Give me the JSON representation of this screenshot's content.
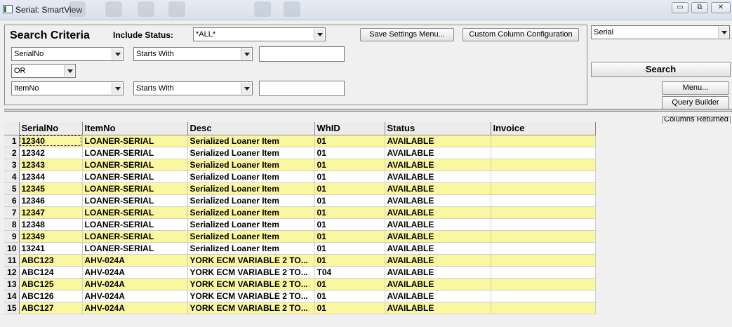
{
  "window": {
    "title": "Serial: SmartView",
    "controls": {
      "minimize": "▭",
      "restore": "⧉",
      "close": "✕"
    }
  },
  "criteria": {
    "title": "Search Criteria",
    "include_status_label": "Include Status:",
    "include_status_value": "*ALL*",
    "save_settings_label": "Save Settings Menu...",
    "custom_columns_label": "Custom Column Configuration",
    "row1": {
      "field": "SerialNo",
      "operator": "Starts With",
      "value": ""
    },
    "logic": "OR",
    "row2": {
      "field": "ItemNo",
      "operator": "Starts With",
      "value": ""
    }
  },
  "right_panel": {
    "view_select": "Serial",
    "search_label": "Search",
    "menu_label": "Menu...",
    "query_builder_label": "Query Builder",
    "columns_returned_label": "Columns Returned"
  },
  "grid": {
    "columns": [
      "SerialNo",
      "ItemNo",
      "Desc",
      "WhID",
      "Status",
      "Invoice"
    ],
    "rows": [
      [
        "12340",
        "LOANER-SERIAL",
        "Serialized Loaner Item",
        "01",
        "AVAILABLE",
        ""
      ],
      [
        "12342",
        "LOANER-SERIAL",
        "Serialized Loaner Item",
        "01",
        "AVAILABLE",
        ""
      ],
      [
        "12343",
        "LOANER-SERIAL",
        "Serialized Loaner Item",
        "01",
        "AVAILABLE",
        ""
      ],
      [
        "12344",
        "LOANER-SERIAL",
        "Serialized Loaner Item",
        "01",
        "AVAILABLE",
        ""
      ],
      [
        "12345",
        "LOANER-SERIAL",
        "Serialized Loaner Item",
        "01",
        "AVAILABLE",
        ""
      ],
      [
        "12346",
        "LOANER-SERIAL",
        "Serialized Loaner Item",
        "01",
        "AVAILABLE",
        ""
      ],
      [
        "12347",
        "LOANER-SERIAL",
        "Serialized Loaner Item",
        "01",
        "AVAILABLE",
        ""
      ],
      [
        "12348",
        "LOANER-SERIAL",
        "Serialized Loaner Item",
        "01",
        "AVAILABLE",
        ""
      ],
      [
        "12349",
        "LOANER-SERIAL",
        "Serialized Loaner Item",
        "01",
        "AVAILABLE",
        ""
      ],
      [
        "13241",
        "LOANER-SERIAL",
        "Serialized Loaner Item",
        "01",
        "AVAILABLE",
        ""
      ],
      [
        "ABC123",
        "AHV-024A",
        "YORK ECM VARIABLE 2 TO...",
        "01",
        "AVAILABLE",
        ""
      ],
      [
        "ABC124",
        "AHV-024A",
        "YORK ECM VARIABLE 2 TO...",
        "T04",
        "AVAILABLE",
        ""
      ],
      [
        "ABC125",
        "AHV-024A",
        "YORK ECM VARIABLE 2 TO...",
        "01",
        "AVAILABLE",
        ""
      ],
      [
        "ABC126",
        "AHV-024A",
        "YORK ECM VARIABLE 2 TO...",
        "01",
        "AVAILABLE",
        ""
      ],
      [
        "ABC127",
        "AHV-024A",
        "YORK ECM VARIABLE 2 TO...",
        "01",
        "AVAILABLE",
        ""
      ]
    ]
  },
  "colors": {
    "odd_row": "#fbf6a0",
    "even_row": "#ffffff",
    "header": "#ececec"
  }
}
